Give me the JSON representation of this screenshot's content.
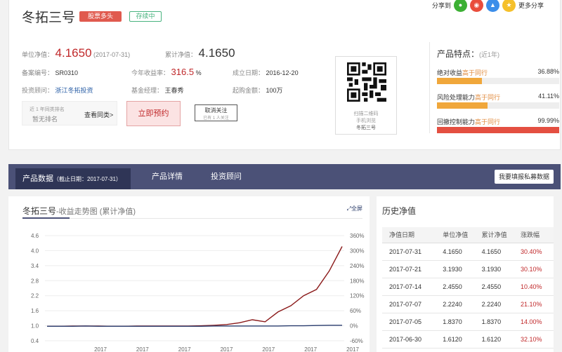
{
  "fund": {
    "name": "冬拓三号",
    "tag1": "股票多头",
    "tag2": "存续中",
    "unit_nav_label": "单位净值：",
    "unit_nav": "4.1650",
    "unit_nav_date": "(2017-07-31)",
    "acc_nav_label": "累计净值：",
    "acc_nav": "4.1650",
    "record_label": "备案编号：",
    "record": "SR0310",
    "ytd_label": "今年收益率：",
    "ytd": "316.5",
    "ytd_unit": "%",
    "founded_label": "成立日期：",
    "founded": "2016-12-20",
    "advisor_label": "投资顾问：",
    "advisor": "浙江冬拓投资",
    "manager_label": "基金经理：",
    "manager": "王春秀",
    "min_label": "起购金额：",
    "min": "100万"
  },
  "share": {
    "label": "分享到",
    "more": "更多分享",
    "colors": {
      "wechat": "#3cb034",
      "weibo": "#e94d3c",
      "qq": "#3c8ee9",
      "qzone": "#f5c02b"
    }
  },
  "rank": {
    "line1": "近 1 年同类排名",
    "line2": "暂无排名",
    "link": "查看同类>"
  },
  "buttons": {
    "appointment": "立即预约",
    "unfollow": "取消关注",
    "followers": "已有 1 人关注"
  },
  "qr": {
    "line1": "扫描二维码",
    "line2": "手机浏览",
    "line3": "冬拓三号"
  },
  "features": {
    "title": "产品特点：",
    "period": "(近1年)",
    "items": [
      {
        "name": "绝对收益",
        "level": "高于同行",
        "pct": "36.88%",
        "value": 0.3688,
        "color": "#f0a73b"
      },
      {
        "name": "风险处理能力",
        "level": "高于同行",
        "pct": "41.11%",
        "value": 0.4111,
        "color": "#f0a73b"
      },
      {
        "name": "回撤控制能力",
        "level": "高于同行",
        "pct": "99.99%",
        "value": 0.9999,
        "color": "#e44f41"
      }
    ]
  },
  "tabs": {
    "data": "产品数据",
    "data_date": "（截止日期：2017-07-31）",
    "detail": "产品详情",
    "advisor": "投资顾问",
    "report": "我要填报私募数据"
  },
  "chart_panel": {
    "title": "冬拓三号",
    "subtitle": "-收益走势图 (累计净值)",
    "fullscreen": "全屏"
  },
  "chart_data": {
    "type": "line",
    "x_tick_labels": [
      "2017",
      "2017",
      "2017",
      "2017",
      "2017",
      "2017",
      "2017"
    ],
    "y_left_ticks": [
      "4.6",
      "4.0",
      "3.4",
      "2.8",
      "2.2",
      "1.6",
      "1.0",
      "0.4"
    ],
    "y_left_values": [
      4.6,
      4.0,
      3.4,
      2.8,
      2.2,
      1.6,
      1.0,
      0.4
    ],
    "y_right_ticks": [
      "360%",
      "300%",
      "240%",
      "180%",
      "120%",
      "60%",
      "0%",
      "-60%"
    ],
    "ylim": [
      0.4,
      4.6
    ],
    "series": [
      {
        "color": "#8b1a1a",
        "values": [
          0.98,
          0.98,
          0.99,
          0.99,
          0.99,
          0.98,
          0.98,
          0.99,
          0.99,
          0.99,
          0.99,
          0.99,
          1.0,
          1.02,
          1.05,
          1.12,
          1.24,
          1.16,
          1.55,
          1.8,
          2.2,
          2.45,
          3.19,
          4.165
        ]
      },
      {
        "color": "#2a3d6e",
        "values": [
          0.98,
          0.98,
          0.98,
          0.99,
          0.98,
          0.98,
          0.98,
          0.98,
          0.98,
          0.98,
          0.98,
          0.98,
          0.98,
          0.99,
          0.99,
          0.99,
          0.99,
          0.99,
          0.99,
          1.0,
          1.0,
          1.01,
          1.02,
          1.02
        ]
      }
    ]
  },
  "history": {
    "title": "历史净值",
    "headers": [
      "净值日期",
      "单位净值",
      "累计净值",
      "涨跌幅"
    ],
    "rows": [
      [
        "2017-07-31",
        "4.1650",
        "4.1650",
        "30.40%"
      ],
      [
        "2017-07-21",
        "3.1930",
        "3.1930",
        "30.10%"
      ],
      [
        "2017-07-14",
        "2.4550",
        "2.4550",
        "10.40%"
      ],
      [
        "2017-07-07",
        "2.2240",
        "2.2240",
        "21.10%"
      ],
      [
        "2017-07-05",
        "1.8370",
        "1.8370",
        "14.00%"
      ],
      [
        "2017-06-30",
        "1.6120",
        "1.6120",
        "32.10%"
      ]
    ]
  }
}
